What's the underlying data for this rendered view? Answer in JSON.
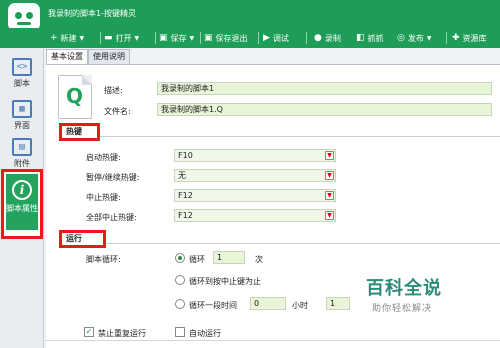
{
  "app": {
    "title": "我录制的脚本1-按键精灵"
  },
  "toolbar": {
    "new_label": "新建",
    "open_label": "打开",
    "save_label": "保存",
    "save_exit_label": "保存退出",
    "debug_label": "调试",
    "record_label": "录制",
    "capture_label": "抓抓",
    "publish_label": "发布",
    "resources_label": "资源库"
  },
  "sidebar": {
    "items": [
      {
        "label": "脚本",
        "icon": "script-icon"
      },
      {
        "label": "界面",
        "icon": "interface-icon"
      },
      {
        "label": "附件",
        "icon": "attachment-icon"
      }
    ],
    "active": {
      "label": "脚本属性",
      "icon": "info-icon"
    }
  },
  "tabs": [
    {
      "label": "基本设置"
    },
    {
      "label": "使用说明"
    }
  ],
  "basic": {
    "desc_label": "描述:",
    "desc_value": "我录制的脚本1",
    "filename_label": "文件名:",
    "filename_value": "我录制的脚本1.Q",
    "file_icon_letter": "Q"
  },
  "hotkeys": {
    "section_title": "热键",
    "rows": [
      {
        "label": "启动热键:",
        "value": "F10"
      },
      {
        "label": "暂停/继续热键:",
        "value": "无"
      },
      {
        "label": "中止热键:",
        "value": "F12"
      },
      {
        "label": "全部中止热键:",
        "value": "F12"
      }
    ]
  },
  "run": {
    "section_title": "运行",
    "loop_label": "脚本循环:",
    "opt_loop": "循环",
    "loop_count": "1",
    "loop_unit": "次",
    "opt_until_stop": "循环到按中止键为止",
    "opt_duration": "循环一段时间",
    "hours": "0",
    "hours_unit": "小时",
    "minutes": "1"
  },
  "options": {
    "no_repeat_label": "禁止重复运行",
    "no_repeat_checked": true,
    "auto_run_label": "自动运行",
    "auto_run_checked": false
  },
  "watermark": {
    "title": "百科全说",
    "subtitle": "助你轻松解决"
  },
  "colors": {
    "accent": "#1d9d57",
    "highlight": "#e81b1b",
    "input_bg": "#e9f5d9"
  }
}
